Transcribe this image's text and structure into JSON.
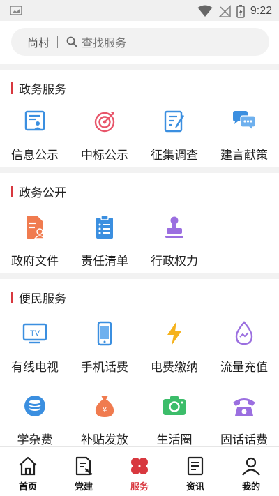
{
  "status": {
    "time": "9:22"
  },
  "search": {
    "location": "尚村",
    "placeholder": "查找服务"
  },
  "sections": [
    {
      "title": "政务服务",
      "items": [
        {
          "label": "信息公示",
          "icon": "info-board-icon",
          "color": "#3b8fe0"
        },
        {
          "label": "中标公示",
          "icon": "target-icon",
          "color": "#e8556a"
        },
        {
          "label": "征集调查",
          "icon": "survey-form-icon",
          "color": "#3b8fe0"
        },
        {
          "label": "建言献策",
          "icon": "chat-bubbles-icon",
          "color": "#3b8fe0"
        }
      ]
    },
    {
      "title": "政务公开",
      "items": [
        {
          "label": "政府文件",
          "icon": "government-file-icon",
          "color": "#f07b4f"
        },
        {
          "label": "责任清单",
          "icon": "clipboard-list-icon",
          "color": "#3b8fe0"
        },
        {
          "label": "行政权力",
          "icon": "seal-stamp-icon",
          "color": "#9b6fe0"
        }
      ]
    },
    {
      "title": "便民服务",
      "items": [
        {
          "label": "有线电视",
          "icon": "tv-icon",
          "color": "#3b8fe0"
        },
        {
          "label": "手机话费",
          "icon": "mobile-phone-icon",
          "color": "#3b8fe0"
        },
        {
          "label": "电费缴纳",
          "icon": "lightning-icon",
          "color": "#f5b21d"
        },
        {
          "label": "流量充值",
          "icon": "data-drop-icon",
          "color": "#9b6fe0"
        },
        {
          "label": "学杂费",
          "icon": "coin-stack-icon",
          "color": "#3b8fe0"
        },
        {
          "label": "补贴发放",
          "icon": "money-bag-icon",
          "color": "#f07b4f"
        },
        {
          "label": "生活圈",
          "icon": "camera-icon",
          "color": "#3cbd6a"
        },
        {
          "label": "固话话费",
          "icon": "telephone-icon",
          "color": "#9b6fe0"
        }
      ]
    }
  ],
  "tabs": [
    {
      "label": "首页",
      "icon": "home-icon",
      "active": false
    },
    {
      "label": "党建",
      "icon": "party-doc-icon",
      "active": false
    },
    {
      "label": "服务",
      "icon": "service-grid-icon",
      "active": true
    },
    {
      "label": "资讯",
      "icon": "news-icon",
      "active": false
    },
    {
      "label": "我的",
      "icon": "profile-icon",
      "active": false
    }
  ],
  "colors": {
    "accent": "#d8383f",
    "background": "#f2f2f2"
  }
}
